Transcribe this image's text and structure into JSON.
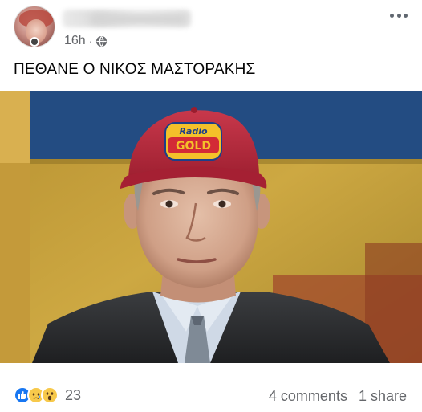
{
  "post": {
    "time": "16h",
    "separator": "·",
    "privacy_icon": "globe-icon",
    "text": "ΠΕΘΑΝΕ Ο ΝΙΚΟΣ ΜΑΣΤΟΡΑΚΗΣ",
    "photo_cap_text_1": "Radio",
    "photo_cap_text_2": "GOLD"
  },
  "footer": {
    "reaction_icons": [
      "like-icon",
      "sad-icon",
      "wow-icon"
    ],
    "reaction_count": "23",
    "comments": "4 comments",
    "shares": "1 share"
  },
  "colors": {
    "brand_blue": "#1877f2",
    "secondary_text": "#65676b",
    "cap_red": "#b2253a"
  }
}
